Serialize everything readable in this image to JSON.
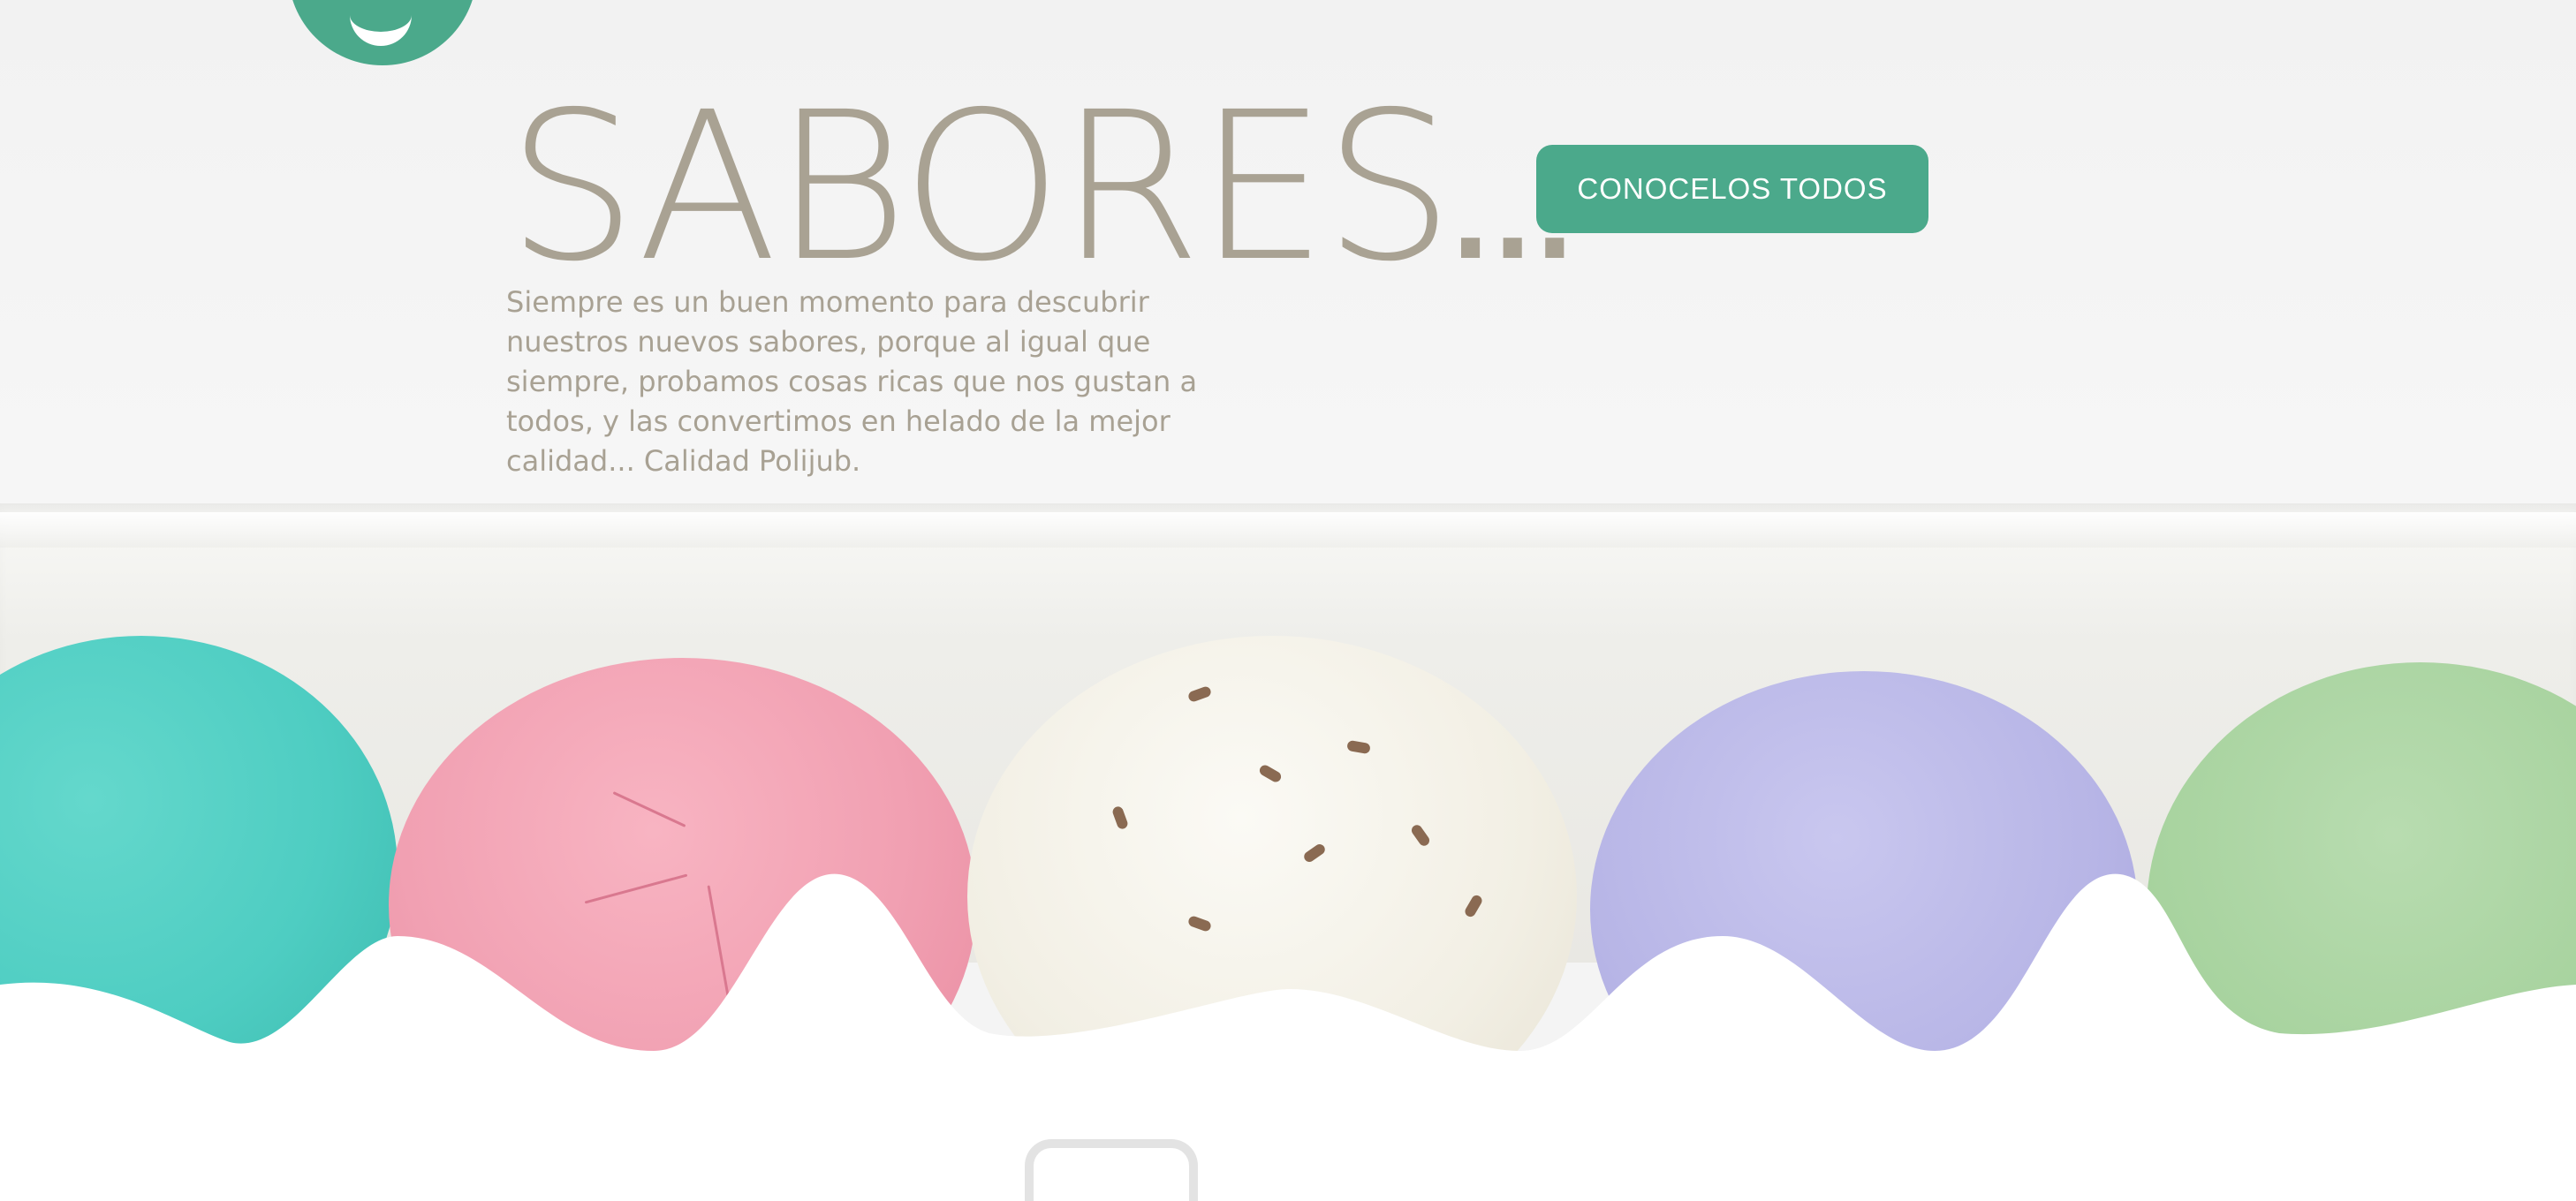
{
  "hero": {
    "title": "SABORES",
    "title_suffix": "...",
    "cta_label": "CONOCELOS TODOS",
    "description": "Siempre es un buen momento para descubrir nuestros nuevos sabores, porque al igual que siempre, probamos cosas ricas que nos gustan a todos, y las convertimos en helado de la mejor calidad... Calidad Polijub."
  },
  "brand": {
    "accent_color": "#4ba98b",
    "title_color": "#a9a293",
    "logo_icon": "logo-badge-icon"
  },
  "scoops": [
    "turquoise",
    "pink",
    "cream-chip",
    "lavender",
    "green"
  ]
}
